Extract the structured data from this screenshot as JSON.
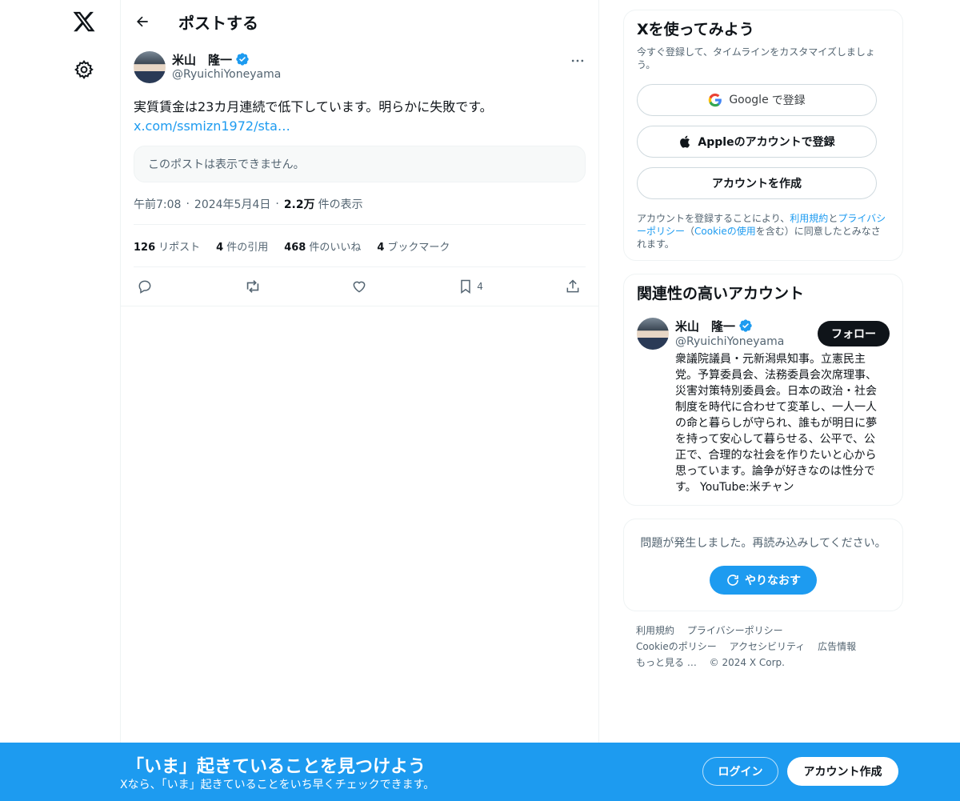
{
  "colors": {
    "accent": "#1d9bf0",
    "text": "#0f1419",
    "muted": "#536471"
  },
  "nav": {
    "logo_icon": "x-logo-icon",
    "settings_icon": "gear-icon"
  },
  "header": {
    "title": "ポストする"
  },
  "post": {
    "author_name": "米山　隆一",
    "author_handle": "@RyuichiYoneyama",
    "text": "実質賃金は23カ月連続で低下しています。明らかに失敗です。",
    "link": "x.com/ssmizn1972/sta…",
    "quote_unavailable": "このポストは表示できません。",
    "time": "午前7:08",
    "date": "2024年5月4日",
    "views_count": "2.2万",
    "views_label": "件の表示",
    "stats": {
      "reposts_count": "126",
      "reposts_label": "リポスト",
      "quotes_count": "4",
      "quotes_label": "件の引用",
      "likes_count": "468",
      "likes_label": "件のいいね",
      "bookmarks_count": "4",
      "bookmarks_label": "ブックマーク"
    },
    "bookmark_action_count": "4"
  },
  "signup": {
    "title": "Xを使ってみよう",
    "subtitle": "今すぐ登録して、タイムラインをカスタマイズしましょう。",
    "google_prefix": "Google",
    "google_suffix": "で登録",
    "apple_label": "Appleのアカウントで登録",
    "create_label": "アカウントを作成",
    "terms_1": "アカウントを登録することにより、",
    "terms_link_1": "利用規約",
    "terms_2": "と",
    "terms_link_2": "プライバシーポリシー",
    "terms_3": "（",
    "terms_link_3": "Cookieの使用",
    "terms_4": "を含む）に同意したとみなされます。"
  },
  "related": {
    "title": "関連性の高いアカウント",
    "name": "米山　隆一",
    "handle": "@RyuichiYoneyama",
    "bio": "衆議院議員・元新潟県知事。立憲民主党。予算委員会、法務委員会次席理事、災害対策特別委員会。日本の政治・社会制度を時代に合わせて変革し、一人一人の命と暮らしが守られ、誰もが明日に夢を持って安心して暮らせる、公平で、公正で、合理的な社会を作りたいと心から思っています。論争が好きなのは性分です。 YouTube:米チャン",
    "follow_label": "フォロー"
  },
  "error": {
    "message": "問題が発生しました。再読み込みしてください。",
    "retry_label": "やりなおす"
  },
  "footer": {
    "links": [
      "利用規約",
      "プライバシーポリシー",
      "Cookieのポリシー",
      "アクセシビリティ",
      "広告情報",
      "もっと見る …"
    ],
    "copyright": "© 2024 X Corp."
  },
  "banner": {
    "title": "「いま」起きていることを見つけよう",
    "subtitle": "Xなら、「いま」起きていることをいち早くチェックできます。",
    "login_label": "ログイン",
    "signup_label": "アカウント作成"
  }
}
